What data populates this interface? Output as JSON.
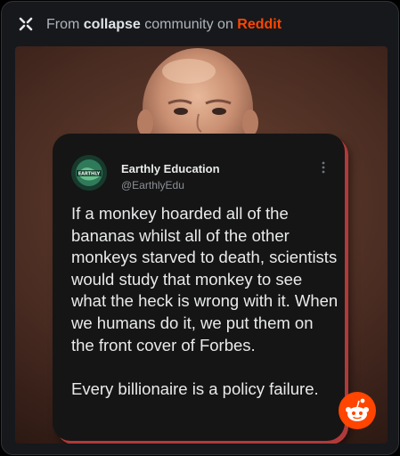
{
  "header": {
    "prefix": "From ",
    "community": "collapse",
    "middle": " community on ",
    "platform": "Reddit",
    "icon": "x-logo-icon",
    "platform_color": "#ff4500"
  },
  "tweet": {
    "display_name": "Earthly Education",
    "handle": "@EarthlyEdu",
    "avatar_text": "EARTHLY",
    "body": "If a monkey hoarded all of the bananas whilst all of the other monkeys starved to death, scientists would study that monkey to see what the heck is wrong with it. When we humans do it, we put them on the front cover of Forbes.\n\nEvery billionaire is a policy failure.",
    "more_icon": "vertical-ellipsis-icon",
    "shadow_color": "#b03a3a"
  },
  "reddit_button": {
    "icon": "reddit-snoo-icon",
    "color": "#ff4500"
  }
}
